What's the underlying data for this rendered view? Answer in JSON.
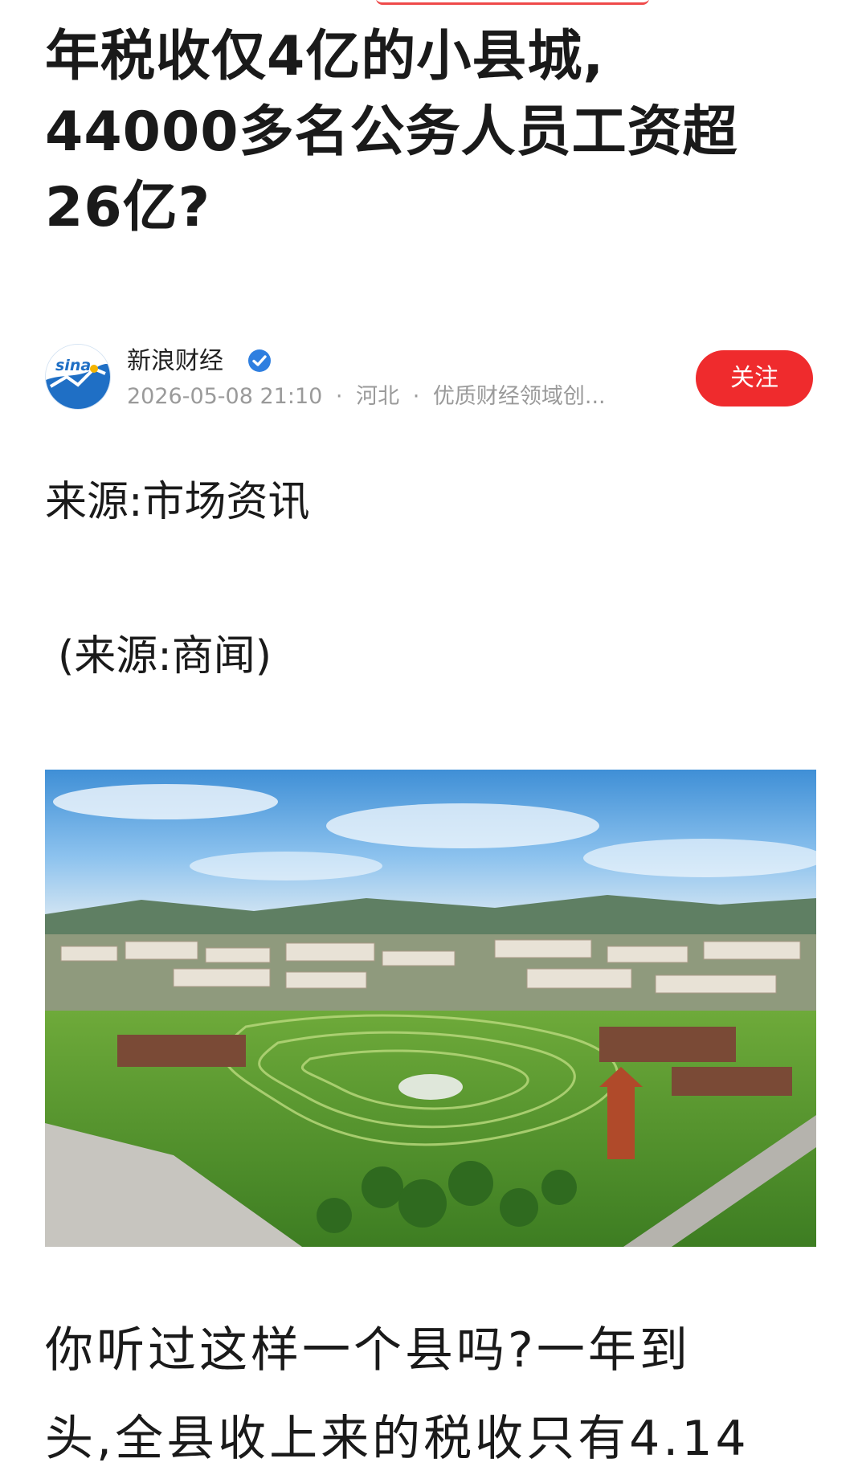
{
  "article": {
    "title_lines": [
      "年税收仅4亿的小县城,",
      "44000多名公务人员工资超",
      "26亿?"
    ],
    "author": {
      "name": "新浪财经",
      "avatar_text": "sina",
      "date": "2026-05-08 21:10",
      "separator": "·",
      "location": "河北",
      "tagline": "优质财经领域创..."
    },
    "follow_label": "关注",
    "source_line_1": "来源:市场资讯",
    "source_line_2": "(来源:商闻)",
    "body_lines": [
      "你听过这样一个县吗?一年到",
      "头,全县收上来的税收只有4.14"
    ]
  },
  "colors": {
    "accent_red": "#ef2b2d",
    "verified_blue": "#2f7fe0",
    "meta_gray": "#9a9a9a",
    "brand_blue": "#1f6fc5"
  },
  "icons": {
    "verified": "verified-badge-icon",
    "avatar": "sina-logo-icon"
  }
}
